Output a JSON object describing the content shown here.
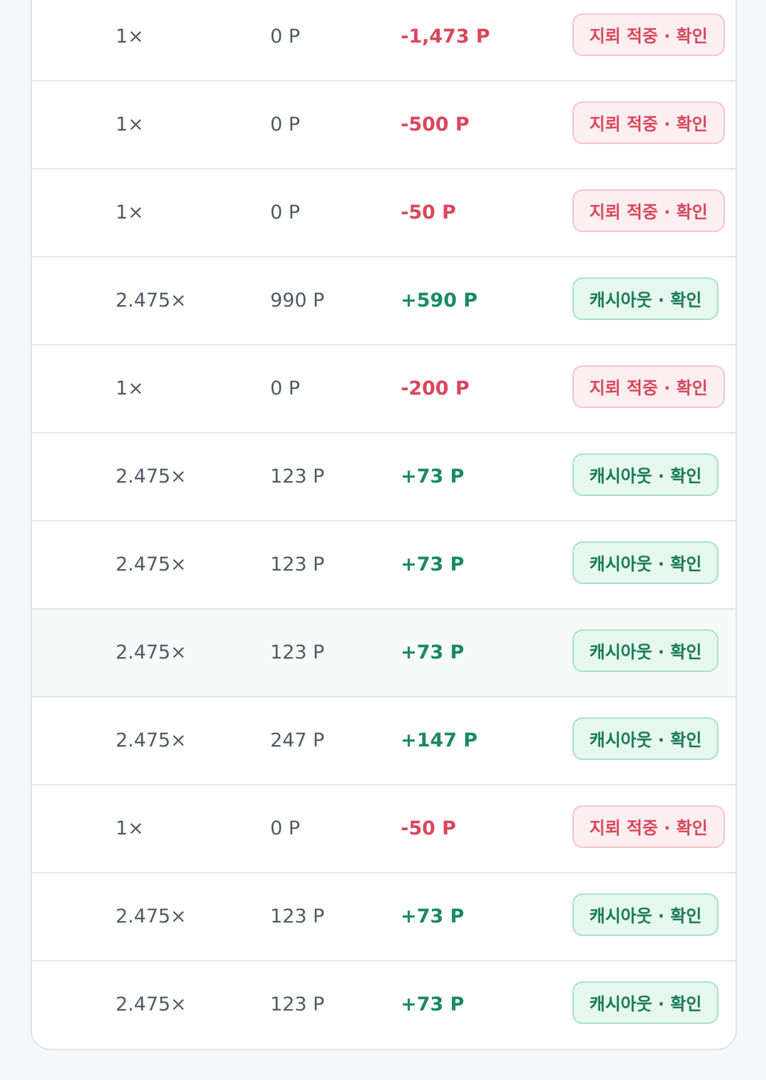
{
  "colors": {
    "negative_text": "#d9475b",
    "positive_text": "#1a8a60",
    "negative_badge_bg": "#fdeff1",
    "positive_badge_bg": "#e6f7ef"
  },
  "rows": [
    {
      "multiplier": "1×",
      "payout": "0 P",
      "profit": "-1,473 P",
      "status": "지뢰 적중 · 확인",
      "type": "loss"
    },
    {
      "multiplier": "1×",
      "payout": "0 P",
      "profit": "-500 P",
      "status": "지뢰 적중 · 확인",
      "type": "loss"
    },
    {
      "multiplier": "1×",
      "payout": "0 P",
      "profit": "-50 P",
      "status": "지뢰 적중 · 확인",
      "type": "loss"
    },
    {
      "multiplier": "2.475×",
      "payout": "990 P",
      "profit": "+590 P",
      "status": "캐시아웃 · 확인",
      "type": "win"
    },
    {
      "multiplier": "1×",
      "payout": "0 P",
      "profit": "-200 P",
      "status": "지뢰 적중 · 확인",
      "type": "loss"
    },
    {
      "multiplier": "2.475×",
      "payout": "123 P",
      "profit": "+73 P",
      "status": "캐시아웃 · 확인",
      "type": "win"
    },
    {
      "multiplier": "2.475×",
      "payout": "123 P",
      "profit": "+73 P",
      "status": "캐시아웃 · 확인",
      "type": "win"
    },
    {
      "multiplier": "2.475×",
      "payout": "123 P",
      "profit": "+73 P",
      "status": "캐시아웃 · 확인",
      "type": "win",
      "highlighted": true
    },
    {
      "multiplier": "2.475×",
      "payout": "247 P",
      "profit": "+147 P",
      "status": "캐시아웃 · 확인",
      "type": "win"
    },
    {
      "multiplier": "1×",
      "payout": "0 P",
      "profit": "-50 P",
      "status": "지뢰 적중 · 확인",
      "type": "loss"
    },
    {
      "multiplier": "2.475×",
      "payout": "123 P",
      "profit": "+73 P",
      "status": "캐시아웃 · 확인",
      "type": "win"
    },
    {
      "multiplier": "2.475×",
      "payout": "123 P",
      "profit": "+73 P",
      "status": "캐시아웃 · 확인",
      "type": "win"
    }
  ]
}
